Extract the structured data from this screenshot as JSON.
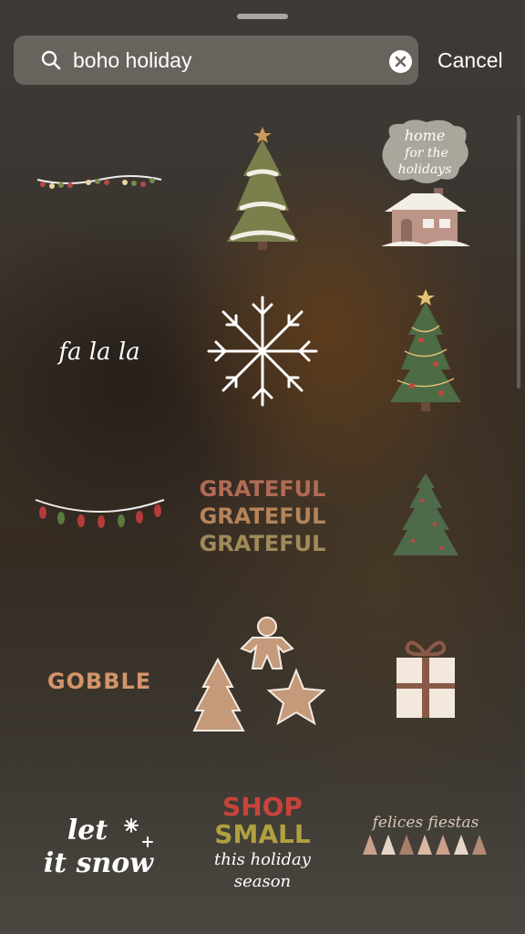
{
  "search": {
    "query": "boho holiday",
    "cancel_label": "Cancel"
  },
  "stickers": [
    {
      "name": "string lights"
    },
    {
      "name": "christmas tree"
    },
    {
      "name": "cabin",
      "text_lines": [
        "home",
        "for the",
        "holidays"
      ]
    },
    {
      "name": "fa la la text",
      "text": "fa la la"
    },
    {
      "name": "snowflake"
    },
    {
      "name": "lit christmas tree"
    },
    {
      "name": "colored string lights"
    },
    {
      "name": "grateful text",
      "lines": [
        "GRATEFUL",
        "GRATEFUL",
        "GRATEFUL"
      ]
    },
    {
      "name": "green tree"
    },
    {
      "name": "gobble text",
      "text": "GOBBLE"
    },
    {
      "name": "gingerbread cookies"
    },
    {
      "name": "gift box"
    },
    {
      "name": "let it snow",
      "lines": [
        "let",
        "it snow"
      ]
    },
    {
      "name": "shop small",
      "lines": [
        "SHOP",
        "SMALL",
        "this holiday",
        "season"
      ]
    },
    {
      "name": "felices fiestas",
      "text": "felices fiestas"
    }
  ],
  "colors": {
    "tree_green": "#6b7a4a",
    "tree_dark": "#4f6a4a",
    "grateful": [
      "#b06a55",
      "#b5845a",
      "#a08a5a"
    ],
    "gobble": "#d4946a",
    "shop": "#c8443a",
    "small": "#b0a040",
    "gift": "#f2e8dc",
    "ribbon": "#8a5a48"
  }
}
